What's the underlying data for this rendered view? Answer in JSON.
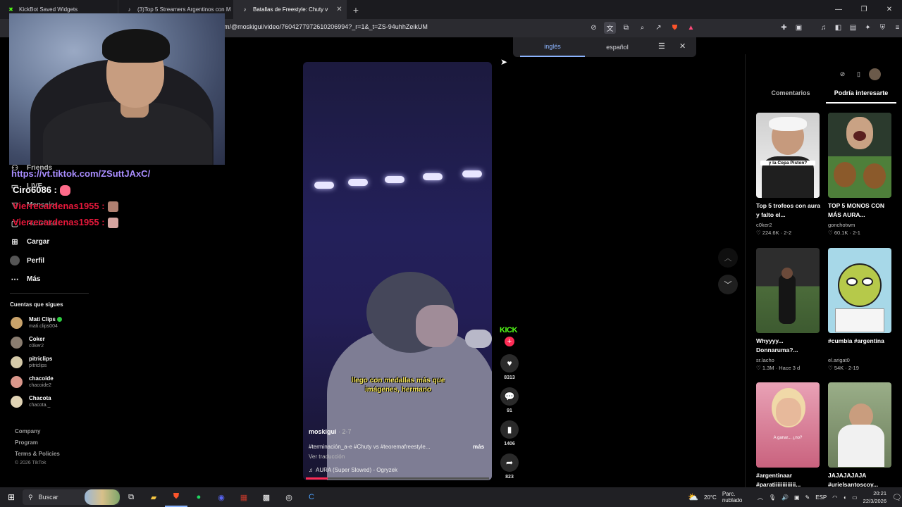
{
  "browser": {
    "tabs": [
      {
        "title": "KickBot Saved Widgets",
        "icon": "kickbot-icon",
        "color": "#53fc18"
      },
      {
        "title": "(3)Top 5 Streamers Argentinos con M",
        "icon": "tiktok-icon",
        "color": "#ffffff"
      },
      {
        "title": "Batallas de Freestyle: Chuty v",
        "icon": "tiktok-icon",
        "color": "#ffffff",
        "active": true
      }
    ],
    "url": "m/@moskigui/video/7604277972610206994?_r=1&_t=ZS-94uhhZeikUM"
  },
  "translate": {
    "source": "inglés",
    "target": "español"
  },
  "overlay": {
    "link": "https://vt.tiktok.com/ZSuttJAxC/",
    "messages": [
      {
        "user": "Ciro6086 :",
        "color": "#ffffff"
      },
      {
        "user": "Vierrecardenas1955 :",
        "color": "#e8183b"
      },
      {
        "user": "Vierrecardenas1955 :",
        "color": "#e8183b"
      }
    ]
  },
  "sidebar": {
    "nav": [
      {
        "label": "Friends",
        "icon": "friends-icon"
      },
      {
        "label": "LIVE",
        "icon": "live-icon"
      },
      {
        "label": "Mensajes",
        "icon": "messages-icon"
      },
      {
        "label": "Actividad",
        "icon": "activity-icon"
      },
      {
        "label": "Cargar",
        "icon": "upload-icon"
      },
      {
        "label": "Perfil",
        "icon": "profile-icon"
      },
      {
        "label": "Más",
        "icon": "more-icon"
      }
    ],
    "following_title": "Cuentas que sigues",
    "following": [
      {
        "name": "Mati Clips",
        "handle": "mati.clips004",
        "verified": true,
        "color": "#c9a36b"
      },
      {
        "name": "Coker",
        "handle": "c0ker2",
        "color": "#8a7d70"
      },
      {
        "name": "pitriclips",
        "handle": "pitriclips",
        "color": "#d4c9a8"
      },
      {
        "name": "chacoide",
        "handle": "chacoide2",
        "color": "#d9968a"
      },
      {
        "name": "Chacota",
        "handle": "chacota._",
        "color": "#e0d3b4"
      }
    ],
    "footer": [
      "Company",
      "Program",
      "Terms & Policies"
    ],
    "copyright": "© 2026 TikTok"
  },
  "video": {
    "subtitle": "llego con medallas más que imágenes, hermano",
    "author": "moskigui",
    "date": "· 2-7",
    "description": "#terminación_a-e #Chuty vs #teoremafreestyle...",
    "more": "más",
    "translate_label": "Ver traducción",
    "music": "AURA (Super Slowed) - Ogryzek",
    "progress": 0.12,
    "kick_badge": "KICK",
    "likes": "8313",
    "comments": "91",
    "saves": "1406",
    "shares": "823"
  },
  "right_panel": {
    "tabs": [
      "Comentarios",
      "Podría interesarte"
    ],
    "active_tab": "Podría interesarte",
    "cards": [
      {
        "title": "Top 5 trofeos con aura y falto el...",
        "user": "c0ker2",
        "likes": "224.6K",
        "date": "2-2",
        "thumb_text": "y la Copa Piston?",
        "bg": "#d9d6cf"
      },
      {
        "title": "TOP 5 MONOS CON MÁS AURA...",
        "user": "gonchotwm",
        "likes": "60.1K",
        "date": "2-1",
        "thumb_text": "",
        "bg": "#5a8a3c"
      },
      {
        "title": "Whyyyy... Donnaruma?...",
        "user": "sr.lacho",
        "likes": "1.3M",
        "date": "Hace 3 d",
        "thumb_text": "",
        "bg": "#3b4a33"
      },
      {
        "title": "#cumbia #argentina",
        "user": "el.arigat0",
        "likes": "54K",
        "date": "2-19",
        "thumb_text": "",
        "bg": "#f2e6a8"
      },
      {
        "title": "#argentinaar #paratiiiiiiiiiiiii...",
        "user": "",
        "likes": "",
        "date": "",
        "thumb_text": "A ganar... ¿no?",
        "bg": "#e88aa0"
      },
      {
        "title": "JAJAJAJAJA #urielsantoscoy...",
        "user": "",
        "likes": "",
        "date": "",
        "thumb_text": "",
        "bg": "#8b9d77"
      }
    ]
  },
  "taskbar": {
    "search": "Buscar",
    "weather": "20°C",
    "weather_text": "Parc. nublado",
    "lang": "ESP",
    "time": "20:21",
    "date": "22/3/2026"
  }
}
